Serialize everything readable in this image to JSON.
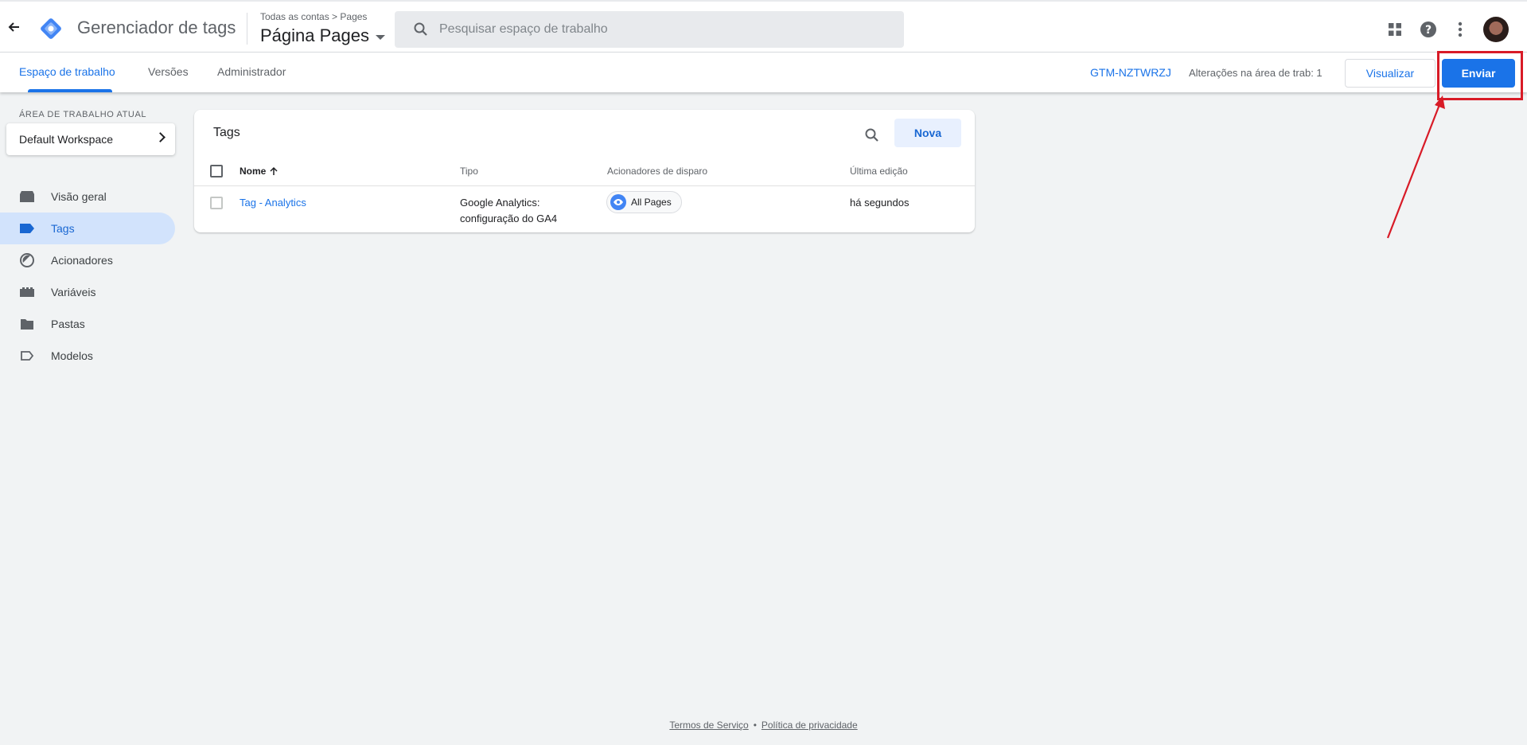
{
  "header": {
    "app_title": "Gerenciador de tags",
    "breadcrumb": "Todas as contas > Pages",
    "container_name": "Página Pages",
    "search_placeholder": "Pesquisar espaço de trabalho"
  },
  "subnav": {
    "tabs": [
      {
        "label": "Espaço de trabalho",
        "active": true
      },
      {
        "label": "Versões",
        "active": false
      },
      {
        "label": "Administrador",
        "active": false
      }
    ],
    "container_id": "GTM-NZTWRZJ",
    "changes_text": "Alterações na área de trab: 1",
    "preview_label": "Visualizar",
    "submit_label": "Enviar"
  },
  "sidebar": {
    "workspace_label": "ÁREA DE TRABALHO ATUAL",
    "workspace_name": "Default Workspace",
    "items": [
      {
        "label": "Visão geral",
        "icon": "overview-icon",
        "active": false
      },
      {
        "label": "Tags",
        "icon": "tag-icon",
        "active": true
      },
      {
        "label": "Acionadores",
        "icon": "trigger-icon",
        "active": false
      },
      {
        "label": "Variáveis",
        "icon": "variables-icon",
        "active": false
      },
      {
        "label": "Pastas",
        "icon": "folder-icon",
        "active": false
      },
      {
        "label": "Modelos",
        "icon": "template-icon",
        "active": false
      }
    ]
  },
  "tags_card": {
    "title": "Tags",
    "new_label": "Nova",
    "columns": {
      "name": "Nome",
      "type": "Tipo",
      "triggers": "Acionadores de disparo",
      "last_edit": "Última edição"
    },
    "rows": [
      {
        "name": "Tag - Analytics",
        "type_line1": "Google Analytics:",
        "type_line2": "configuração do GA4",
        "trigger": "All Pages",
        "last_edit": "há segundos"
      }
    ]
  },
  "footer": {
    "terms": "Termos de Serviço",
    "separator": "•",
    "privacy": "Política de privacidade"
  },
  "colors": {
    "accent": "#1a73e8",
    "annotation": "#d81b27",
    "background": "#f1f3f4"
  }
}
